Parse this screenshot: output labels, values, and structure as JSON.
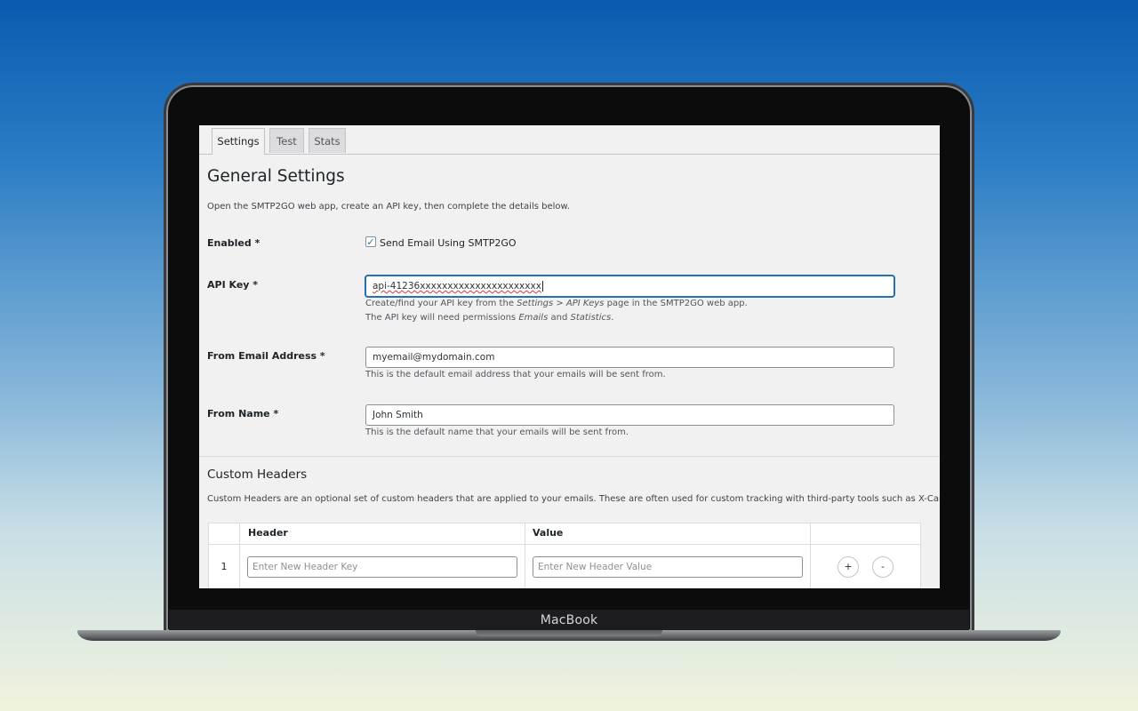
{
  "device": {
    "label": "MacBook"
  },
  "tabs": [
    {
      "label": "Settings",
      "active": true
    },
    {
      "label": "Test",
      "active": false
    },
    {
      "label": "Stats",
      "active": false
    }
  ],
  "general": {
    "title": "General Settings",
    "intro": "Open the SMTP2GO web app, create an API key, then complete the details below."
  },
  "enabled": {
    "label": "Enabled *",
    "checkbox_label": "Send Email Using SMTP2GO",
    "checked": true
  },
  "api_key": {
    "label": "API Key *",
    "value": "api-41236xxxxxxxxxxxxxxxxxxxxxx",
    "desc1_a": "Create/find your API key from the ",
    "desc1_em": "Settings > API Keys",
    "desc1_b": " page in the SMTP2GO web app.",
    "desc2_a": "The API key will need permissions ",
    "desc2_em1": "Emails",
    "desc2_mid": " and ",
    "desc2_em2": "Statistics",
    "desc2_end": "."
  },
  "from_email": {
    "label": "From Email Address *",
    "value": "myemail@mydomain.com",
    "desc": "This is the default email address that your emails will be sent from."
  },
  "from_name": {
    "label": "From Name *",
    "value": "John Smith",
    "desc": "This is the default name that your emails will be sent from."
  },
  "custom_headers": {
    "title": "Custom Headers",
    "desc": "Custom Headers are an optional set of custom headers that are applied to your emails. These are often used for custom tracking with third-party tools such as X-Campaign.",
    "columns": [
      "Header",
      "Value"
    ],
    "rows": [
      {
        "index": "1",
        "header_placeholder": "Enter New Header Key",
        "value_placeholder": "Enter New Header Value"
      }
    ],
    "add_label": "+",
    "remove_label": "-"
  },
  "colors": {
    "accent": "#2271b1",
    "screen_bg": "#f1f1f1",
    "bezel": "#0c0c0d"
  }
}
